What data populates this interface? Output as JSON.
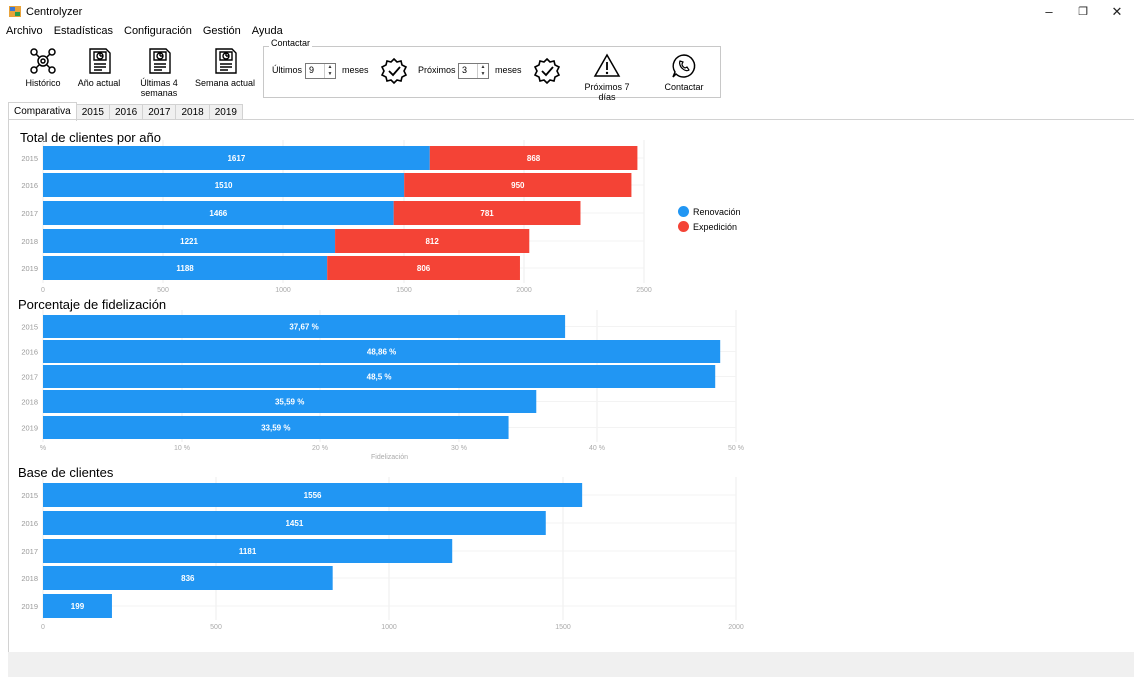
{
  "window": {
    "title": "Centrolyzer",
    "minimize": "–",
    "maximize": "❐",
    "close": "✕"
  },
  "menu": [
    "Archivo",
    "Estadísticas",
    "Configuración",
    "Gestión",
    "Ayuda"
  ],
  "toolbar": {
    "historico": "Histórico",
    "anio_actual": "Año actual",
    "ultimas_4_line1": "Últimas 4",
    "ultimas_4_line2": "semanas",
    "semana_actual": "Semana actual",
    "contactar_group": "Contactar",
    "ultimos_label": "Últimos",
    "ultimos_value": "9",
    "meses_1": "meses",
    "proximos_label": "Próximos",
    "proximos_value": "3",
    "meses_2": "meses",
    "proximos_7": "Próximos 7 días",
    "contactar_btn": "Contactar"
  },
  "tabs": [
    "Comparativa",
    "2015",
    "2016",
    "2017",
    "2018",
    "2019"
  ],
  "colors": {
    "renovacion": "#2196f3",
    "expedicion": "#f44336"
  },
  "chart_data": [
    {
      "type": "bar",
      "orientation": "horizontal",
      "stacked": true,
      "title": "Total de clientes por año",
      "categories": [
        "2015",
        "2016",
        "2017",
        "2018",
        "2019"
      ],
      "series": [
        {
          "name": "Renovación",
          "values": [
            1617,
            1510,
            1466,
            1221,
            1188
          ]
        },
        {
          "name": "Expedición",
          "values": [
            868,
            950,
            781,
            812,
            806
          ]
        }
      ],
      "xlim": [
        0,
        2500
      ],
      "xticks": [
        "0",
        "500",
        "1000",
        "1500",
        "2000",
        "2500"
      ],
      "legend": "right"
    },
    {
      "type": "bar",
      "orientation": "horizontal",
      "title": "Porcentaje de fidelización",
      "categories": [
        "2015",
        "2016",
        "2017",
        "2018",
        "2019"
      ],
      "values": [
        37.67,
        48.86,
        48.5,
        35.59,
        33.59
      ],
      "labels": [
        "37,67 %",
        "48,86 %",
        "48,5 %",
        "35,59 %",
        "33,59 %"
      ],
      "xlim": [
        0,
        50
      ],
      "xticks": [
        "%",
        "10 %",
        "20 %",
        "30 %",
        "40 %",
        "50 %"
      ],
      "xlabel": "Fidelización"
    },
    {
      "type": "bar",
      "orientation": "horizontal",
      "title": "Base de clientes",
      "categories": [
        "2015",
        "2016",
        "2017",
        "2018",
        "2019"
      ],
      "values": [
        1556,
        1451,
        1181,
        836,
        199
      ],
      "xlim": [
        0,
        2000
      ],
      "xticks": [
        "0",
        "500",
        "1000",
        "1500",
        "2000"
      ]
    }
  ]
}
